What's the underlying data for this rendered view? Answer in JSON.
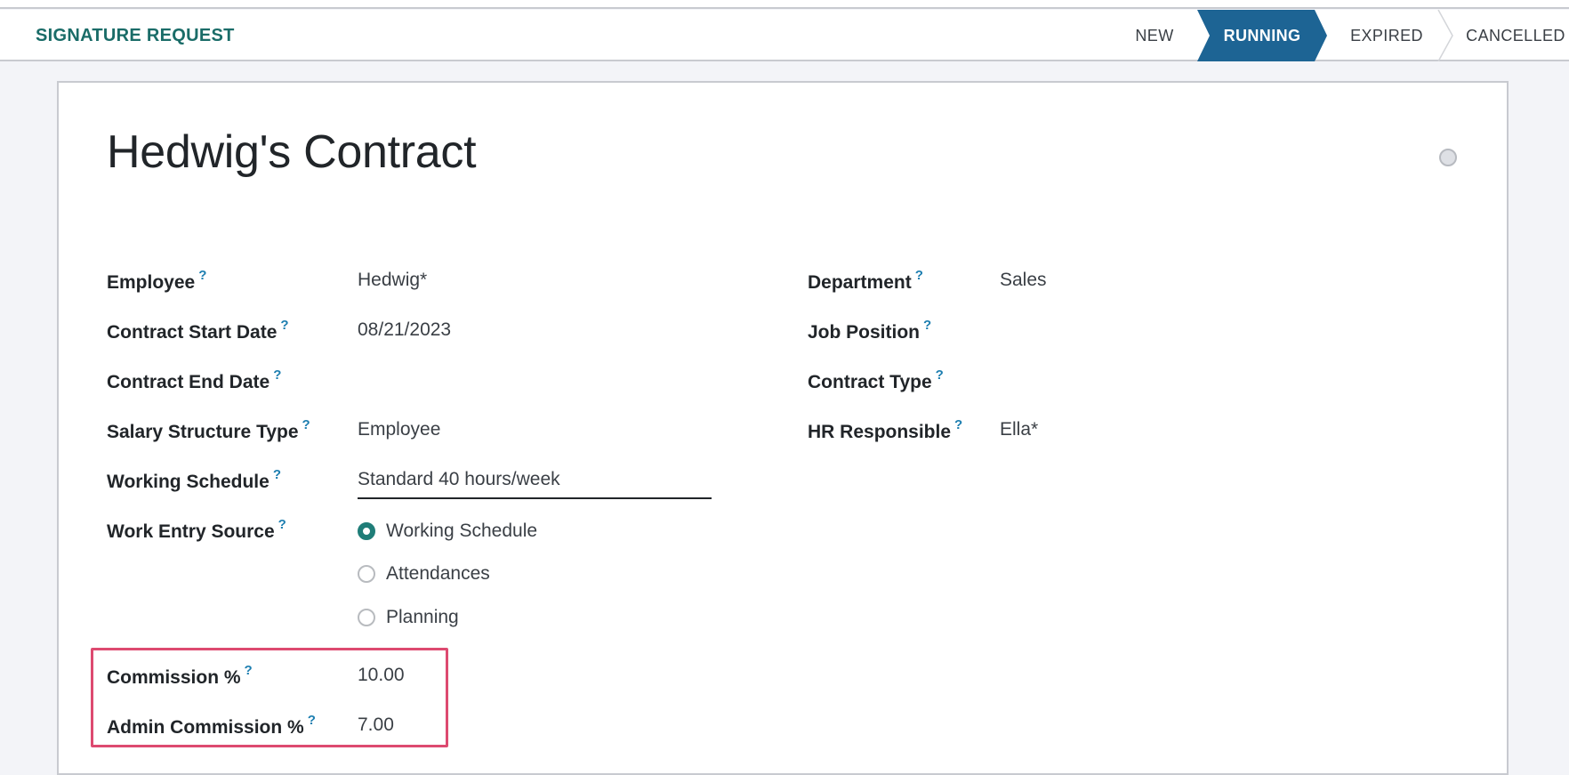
{
  "statusbar": {
    "action_button": "SIGNATURE REQUEST",
    "stages": [
      {
        "label": "NEW",
        "active": false
      },
      {
        "label": "RUNNING",
        "active": true
      },
      {
        "label": "EXPIRED",
        "active": false
      },
      {
        "label": "CANCELLED",
        "active": false
      }
    ],
    "active_color": "#1d6494"
  },
  "form": {
    "title": "Hedwig's Contract",
    "help_glyph": "?",
    "left_fields": [
      {
        "label": "Employee",
        "value": "Hedwig*"
      },
      {
        "label": "Contract Start Date",
        "value": "08/21/2023"
      },
      {
        "label": "Contract End Date",
        "value": ""
      },
      {
        "label": "Salary Structure Type",
        "value": "Employee"
      },
      {
        "label": "Working Schedule",
        "value": "Standard 40 hours/week"
      },
      {
        "label": "Work Entry Source",
        "value": "Working Schedule"
      }
    ],
    "work_entry_options": [
      {
        "label": "Working Schedule",
        "checked": true
      },
      {
        "label": "Attendances",
        "checked": false
      },
      {
        "label": "Planning",
        "checked": false
      }
    ],
    "right_fields": [
      {
        "label": "Department",
        "value": "Sales"
      },
      {
        "label": "Job Position",
        "value": ""
      },
      {
        "label": "Contract Type",
        "value": ""
      },
      {
        "label": "HR Responsible",
        "value": "Ella*"
      }
    ],
    "commission_fields": [
      {
        "label": "Commission %",
        "value": "10.00"
      },
      {
        "label": "Admin Commission %",
        "value": "7.00"
      }
    ],
    "highlight_color": "#dd4a70"
  }
}
